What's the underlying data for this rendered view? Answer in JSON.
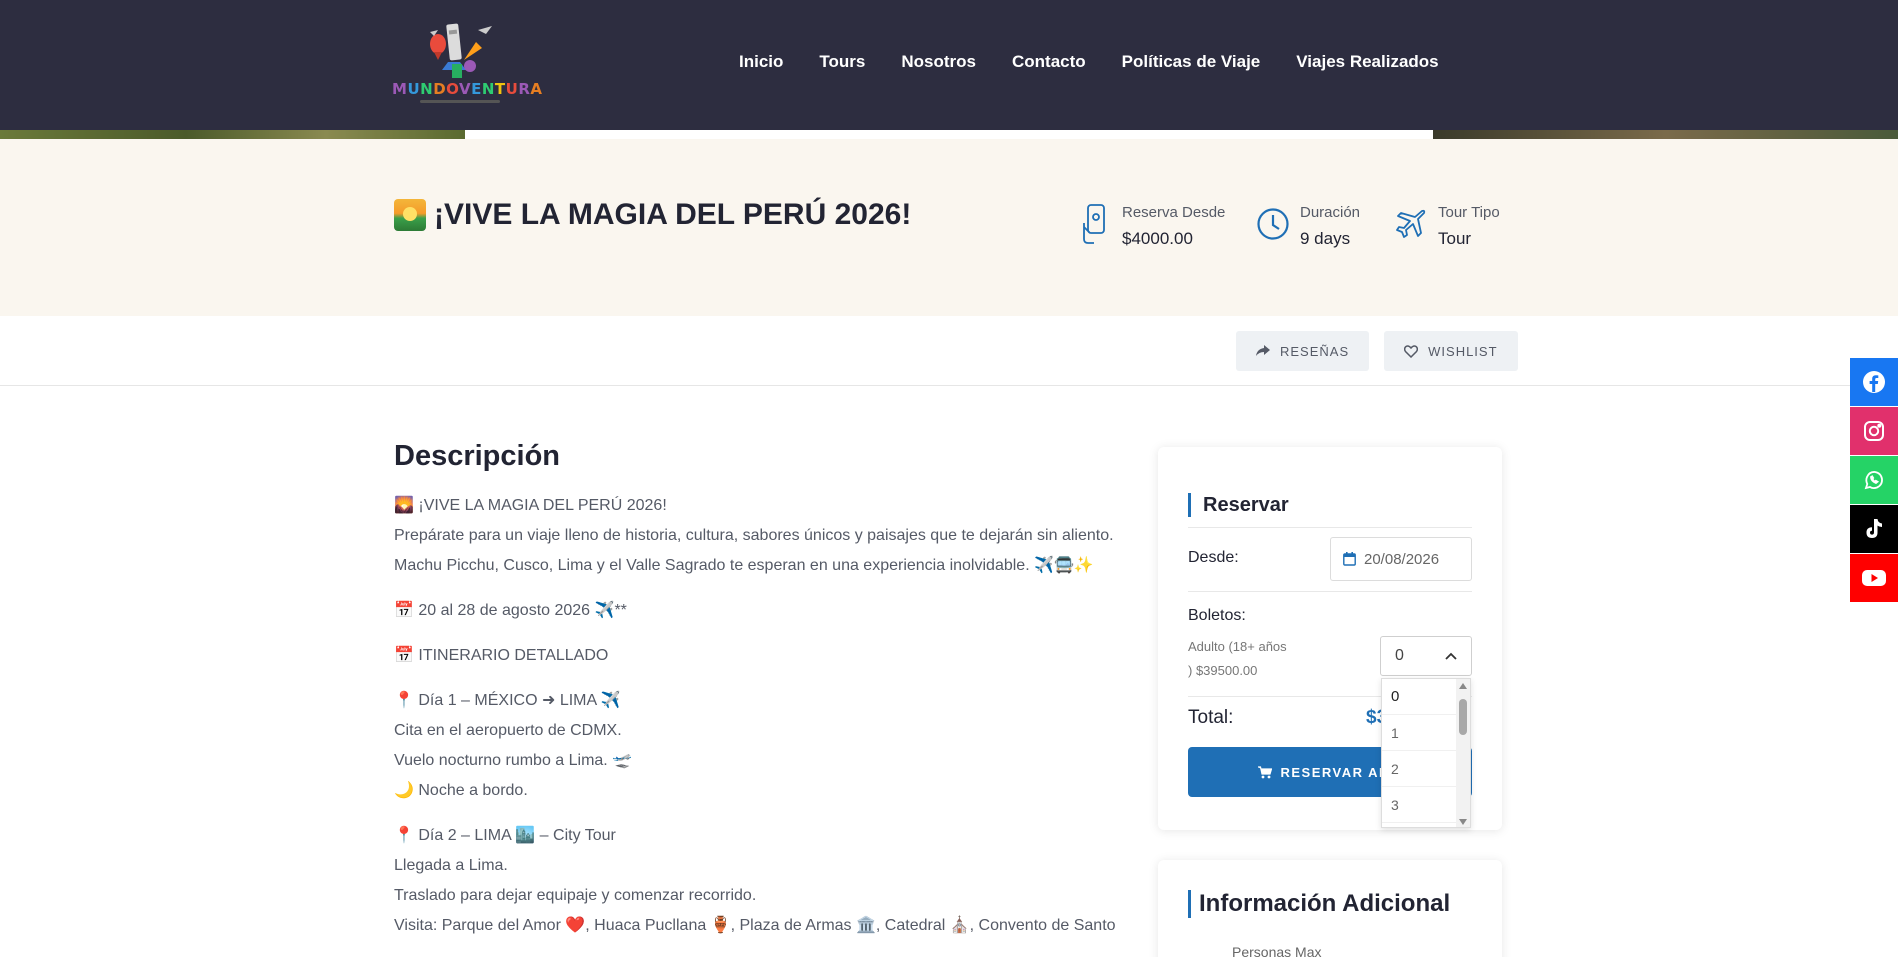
{
  "brand": {
    "logo_text": "MUNDOVENTURA"
  },
  "nav": [
    "Inicio",
    "Tours",
    "Nosotros",
    "Contacto",
    "Políticas de Viaje",
    "Viajes Realizados"
  ],
  "hero": {
    "title": "¡VIVE LA MAGIA DEL PERÚ 2026!",
    "meta": [
      {
        "label": "Reserva Desde",
        "value": "$4000.00",
        "icon": "phone-hand-icon"
      },
      {
        "label": "Duración",
        "value": "9 days",
        "icon": "clock-icon"
      },
      {
        "label": "Tour Tipo",
        "value": "Tour",
        "icon": "plane-icon"
      }
    ]
  },
  "actions": {
    "reviews": "RESEÑAS",
    "wishlist": "WISHLIST"
  },
  "description": {
    "heading": "Descripción",
    "lines": [
      "🌄 ¡VIVE LA MAGIA DEL PERÚ 2026!",
      "Prepárate para un viaje lleno de historia, cultura, sabores únicos y paisajes que te dejarán sin aliento.",
      "Machu Picchu, Cusco, Lima y el Valle Sagrado te esperan en una experiencia inolvidable. ✈️🚍✨",
      "📅 20 al 28 de agosto 2026 ✈️**",
      "📅 ITINERARIO DETALLADO",
      "📍 Día 1 – MÉXICO ➜ LIMA ✈️",
      "Cita en el aeropuerto de CDMX.",
      "Vuelo nocturno rumbo a Lima. 🛫",
      "🌙 Noche a bordo.",
      "📍 Día 2 – LIMA 🏙️ – City Tour",
      "Llegada a Lima.",
      "Traslado para dejar equipaje y comenzar recorrido.",
      "Visita: Parque del Amor ❤️, Huaca Pucllana 🏺, Plaza de Armas 🏛️, Catedral ⛪, Convento de Santo"
    ]
  },
  "booking": {
    "title": "Reservar",
    "from_label": "Desde:",
    "date_value": "20/08/2026",
    "tickets_label": "Boletos:",
    "ticket_desc_line1": "Adulto (18+ años",
    "ticket_desc_line2": ")  $39500.00",
    "selected_qty": "0",
    "qty_options": [
      "0",
      "1",
      "2",
      "3"
    ],
    "total_label": "Total:",
    "total_value": "$3",
    "book_button": "RESERVAR AHO"
  },
  "extra_info": {
    "title": "Información Adicional",
    "first_item": "Personas Max"
  },
  "social": [
    {
      "name": "facebook",
      "color": "#1877f2"
    },
    {
      "name": "instagram",
      "color": "#e1306c"
    },
    {
      "name": "whatsapp",
      "color": "#25d366"
    },
    {
      "name": "tiktok",
      "color": "#000000"
    },
    {
      "name": "youtube",
      "color": "#ff0000"
    }
  ],
  "colors": {
    "header_bg": "#2d2d40",
    "accent": "#1f6fb5",
    "hero_bg": "#faf6ef"
  }
}
